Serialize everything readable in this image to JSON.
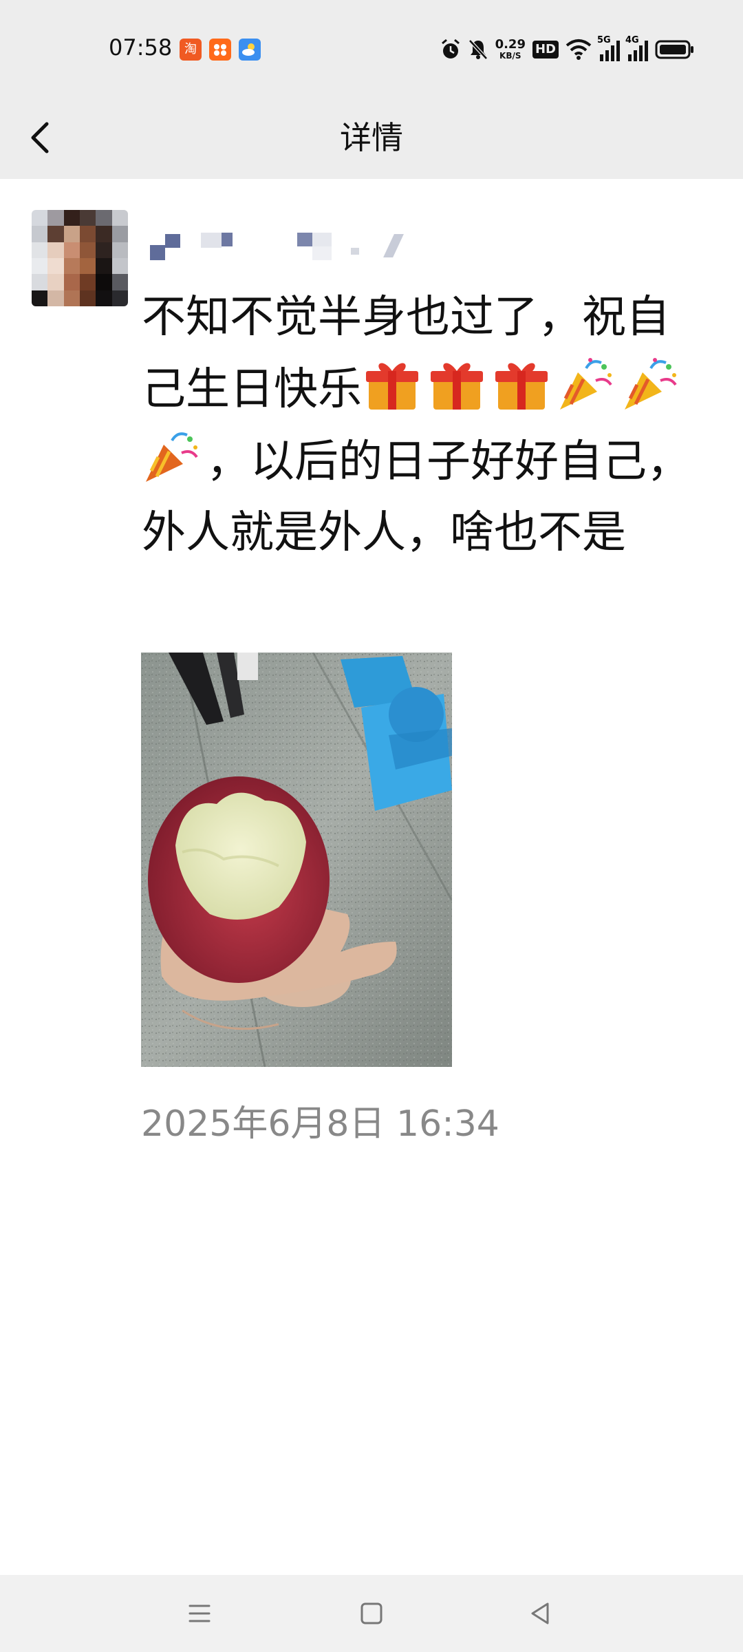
{
  "status_bar": {
    "time": "07:58",
    "apps": [
      "taobao-app-icon",
      "shopping-app-icon",
      "weather-app-icon"
    ],
    "net_speed_value": "0.29",
    "net_speed_unit": "KB/S",
    "hd_label": "HD",
    "signal_1_label": "5G",
    "signal_2_label": "4G"
  },
  "header": {
    "title": "详情"
  },
  "post": {
    "text_1": "不知不觉半身也过了，祝自己生日快乐",
    "text_2": "，以后的日子好好自己，外人就是外人，啥也不是",
    "emoji_sequence": [
      "gift-icon",
      "gift-icon",
      "gift-icon",
      "party-popper-icon",
      "party-popper-icon",
      "party-popper-icon"
    ],
    "timestamp": "2025年6月8日 16:34"
  },
  "colors": {
    "status_bg": "#ededed",
    "header_bg": "#ededed",
    "nav_bg": "#f1f1f1",
    "text": "#111111",
    "muted": "#888888"
  }
}
